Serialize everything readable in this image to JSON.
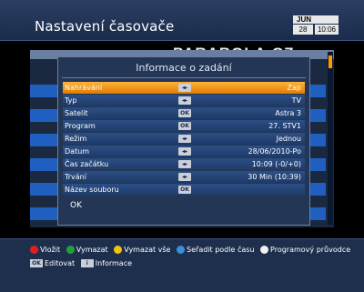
{
  "header": {
    "title": "Nastavení časovače",
    "clock": {
      "month": "JUN",
      "day": "28",
      "time": "10:06"
    }
  },
  "watermark": "PARABOLA.CZ",
  "dialog": {
    "title": "Informace o zadání",
    "rows": [
      {
        "label": "Nahrávání",
        "badge": "◂▸",
        "value": "Zap"
      },
      {
        "label": "Typ",
        "badge": "◂▸",
        "value": "TV"
      },
      {
        "label": "Satelit",
        "badge": "OK",
        "value": "Astra 3"
      },
      {
        "label": "Program",
        "badge": "OK",
        "value": "27. STV1"
      },
      {
        "label": "Režim",
        "badge": "◂▸",
        "value": "Jednou"
      },
      {
        "label": "Datum",
        "badge": "◂▸",
        "value": "28/06/2010-Po"
      },
      {
        "label": "Čas začátku",
        "badge": "◂▸",
        "value": "10:09 (-0/+0)"
      },
      {
        "label": "Trvání",
        "badge": "◂▸",
        "value": "30 Min (10:39)"
      },
      {
        "label": "Název souboru",
        "badge": "OK",
        "value": ""
      }
    ],
    "ok_label": "OK"
  },
  "footer": {
    "red": "Vložit",
    "green": "Vymazat",
    "yellow": "Vymazat vše",
    "blue": "Seřadit podle času",
    "white": "Programový průvodce",
    "ok_key": "OK",
    "ok_text": "Editovat",
    "info_key": "i",
    "info_text": "Informace"
  },
  "colors": {
    "highlight": "#f39200",
    "red": "#e02020",
    "green": "#22a03a",
    "yellow": "#f2c20c",
    "blue": "#3a8fd8",
    "white": "#f0f0f0"
  }
}
